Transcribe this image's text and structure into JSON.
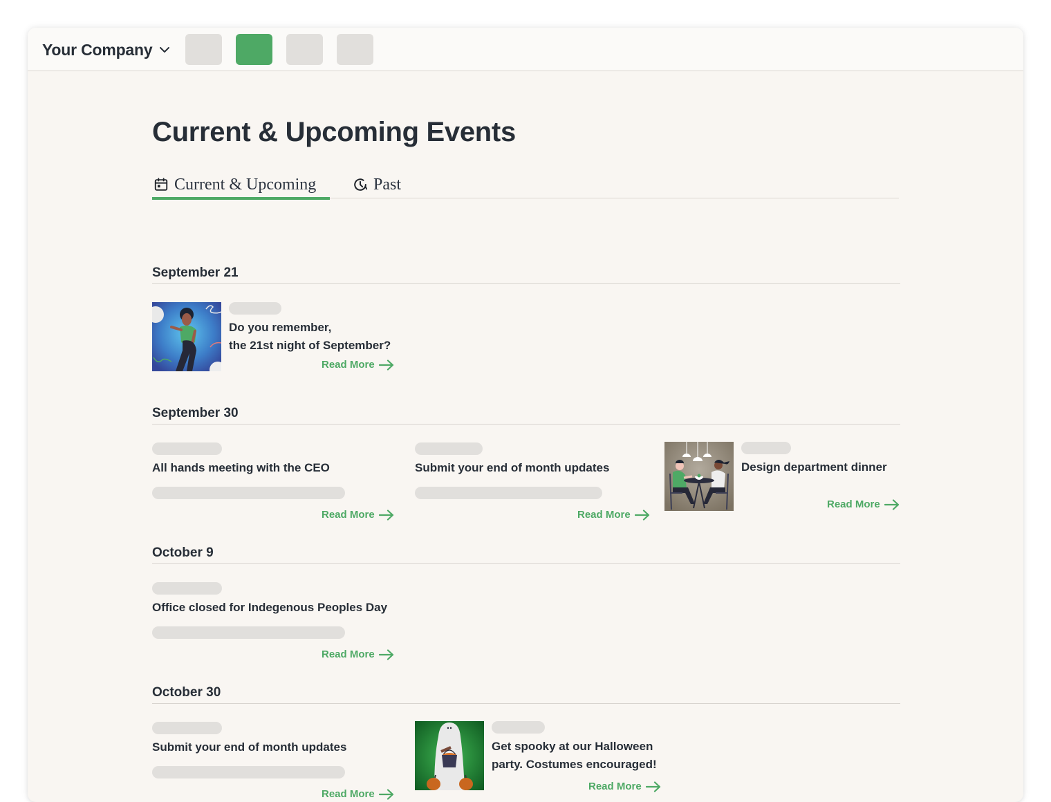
{
  "topbar": {
    "company_name": "Your Company",
    "nav_buttons": [
      {
        "id": "nav-1",
        "active": false
      },
      {
        "id": "nav-2",
        "active": true
      },
      {
        "id": "nav-3",
        "active": false
      },
      {
        "id": "nav-4",
        "active": false
      }
    ]
  },
  "page": {
    "title": "Current & Upcoming Events"
  },
  "tabs": [
    {
      "label": "Current & Upcoming",
      "icon": "calendar-icon",
      "active": true
    },
    {
      "label": "Past",
      "icon": "clock-history-icon",
      "active": false
    }
  ],
  "colors": {
    "accent": "#4ea965",
    "text": "#272e37",
    "placeholder": "#e1dfdc",
    "background": "#f9f6f2"
  },
  "read_more_label": "Read More",
  "sections": [
    {
      "date": "September 21",
      "events": [
        {
          "title_lines": [
            "Do you remember,",
            "the 21st night of September?"
          ],
          "image": "dancing-person-illustration"
        }
      ]
    },
    {
      "date": "September 30",
      "events": [
        {
          "title_lines": [
            "All hands meeting with the CEO"
          ]
        },
        {
          "title_lines": [
            "Submit your end of month updates"
          ]
        },
        {
          "title_lines": [
            "Design department dinner"
          ],
          "image": "dinner-illustration"
        }
      ]
    },
    {
      "date": "October 9",
      "events": [
        {
          "title_lines": [
            "Office closed for Indegenous Peoples Day"
          ]
        }
      ]
    },
    {
      "date": "October 30",
      "events": [
        {
          "title_lines": [
            "Submit your end of month updates"
          ]
        },
        {
          "title_lines": [
            "Get spooky at our Halloween",
            "party. Costumes encouraged!"
          ],
          "image": "ghost-halloween-illustration"
        }
      ]
    }
  ]
}
